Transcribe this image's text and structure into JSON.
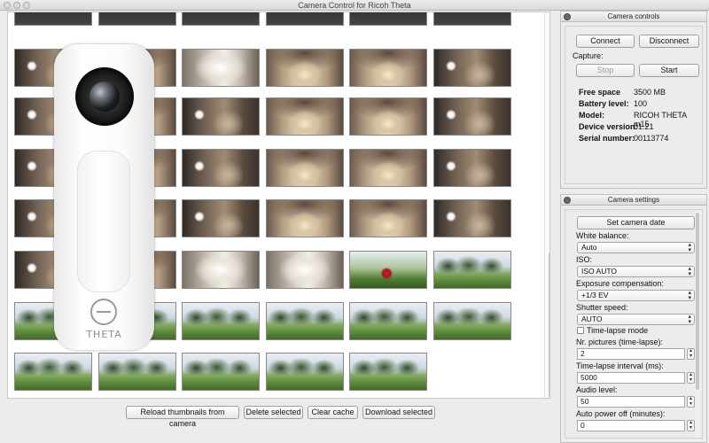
{
  "window": {
    "title": "Camera Control for Ricoh Theta"
  },
  "camera_overlay": {
    "brand": "THETA"
  },
  "gallery": {
    "rows": [
      [
        "topstrip",
        "topstrip",
        "topstrip",
        "topstrip",
        "topstrip",
        "topstrip"
      ],
      [
        "dark",
        "indoor",
        "bright",
        "indoor",
        "indoor",
        "dark"
      ],
      [
        "dark",
        "indoor",
        "dark",
        "indoor",
        "indoor",
        "dark"
      ],
      [
        "dark",
        "indoor",
        "dark",
        "indoor",
        "indoor",
        "dark"
      ],
      [
        "dark",
        "indoor",
        "dark",
        "indoor",
        "indoor",
        "dark"
      ],
      [
        "dark",
        "indoor",
        "bright",
        "bright",
        "redobj",
        "outdoor"
      ],
      [
        "outdoor",
        "outdoor",
        "outdoor",
        "outdoor",
        "outdoor",
        "outdoor"
      ],
      [
        "outdoor",
        "outdoor",
        "outdoor",
        "outdoor",
        "outdoor",
        ""
      ]
    ]
  },
  "bottom_buttons": {
    "reload": "Reload thumbnails from camera",
    "delete": "Delete selected",
    "clear": "Clear cache",
    "download": "Download selected"
  },
  "camera_controls": {
    "header": "Camera controls",
    "connect": "Connect",
    "disconnect": "Disconnect",
    "capture_label": "Capture:",
    "stop": "Stop",
    "start": "Start",
    "info": [
      {
        "key": "Free space",
        "value": "3500 MB"
      },
      {
        "key": "Battery level:",
        "value": "100"
      },
      {
        "key": "Model:",
        "value": "RICOH THETA m15"
      },
      {
        "key": "Device version:",
        "value": "01.21"
      },
      {
        "key": "Serial number:",
        "value": "00113774"
      }
    ]
  },
  "camera_settings": {
    "header": "Camera settings",
    "set_date": "Set camera date",
    "white_balance_label": "White balance:",
    "white_balance_value": "Auto",
    "iso_label": "ISO:",
    "iso_value": "ISO AUTO",
    "exposure_label": "Exposure compensation:",
    "exposure_value": "+1/3 EV",
    "shutter_label": "Shutter speed:",
    "shutter_value": "AUTO",
    "timelapse_label": "Time-lapse mode",
    "nr_pictures_label": "Nr. pictures (time-lapse):",
    "nr_pictures_value": "2",
    "interval_label": "Time-lapse interval (ms):",
    "interval_value": "5000",
    "audio_label": "Audio level:",
    "audio_value": "50",
    "power_off_label": "Auto power off (minutes):",
    "power_off_value": "0"
  }
}
